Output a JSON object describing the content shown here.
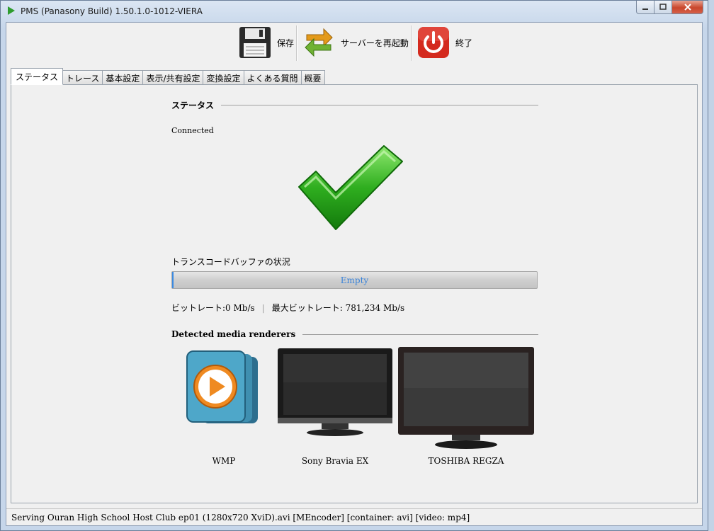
{
  "window": {
    "title": "PMS (Panasony Build) 1.50.1.0-1012-VIERA"
  },
  "toolbar": {
    "save_label": "保存",
    "restart_label": "サーバーを再起動",
    "quit_label": "終了"
  },
  "tabs": [
    {
      "label": "ステータス",
      "active": true
    },
    {
      "label": "トレース"
    },
    {
      "label": "基本設定"
    },
    {
      "label": "表示/共有設定"
    },
    {
      "label": "変換設定"
    },
    {
      "label": "よくある質問"
    },
    {
      "label": "概要"
    }
  ],
  "status": {
    "heading": "ステータス",
    "state": "Connected",
    "icon": "check-icon"
  },
  "buffer": {
    "label": "トランスコードバッファの状況",
    "progress_text": "Empty",
    "progress_fraction": 0
  },
  "bitrate": {
    "current": "ビットレート:0 Mb/s",
    "separator": "|",
    "max": "最大ビットレート: 781,234 Mb/s"
  },
  "renderers": {
    "heading": "Detected media renderers",
    "items": [
      {
        "name": "WMP",
        "icon": "wmp-icon"
      },
      {
        "name": "Sony Bravia EX",
        "icon": "tv-icon"
      },
      {
        "name": "TOSHIBA REGZA",
        "icon": "tv-icon"
      }
    ]
  },
  "statusbar": {
    "message": "Serving Ouran High School Host Club ep01 (1280x720 XviD).avi [MEncoder] [container: avi] [video: mp4]"
  },
  "colors": {
    "progress_text": "#3a83d8",
    "check_green": "#2fae1f",
    "power_red": "#d42a1e"
  }
}
